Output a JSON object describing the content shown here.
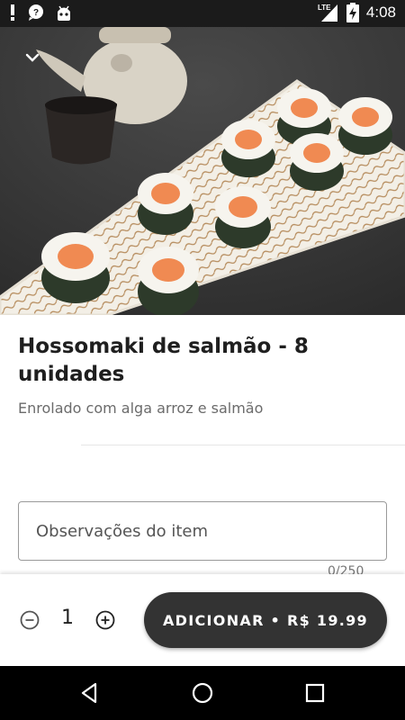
{
  "status_bar": {
    "time": "4:08",
    "network": "LTE",
    "icons": [
      "alert-icon",
      "chat-icon",
      "android-icon",
      "lte-signal-icon",
      "battery-charging-icon"
    ]
  },
  "hero": {
    "image": "sushi-photo",
    "collapse_icon": "chevron-down-icon"
  },
  "product": {
    "title": "Hossomaki de salmão - 8 unidades",
    "description": "Enrolado com alga arroz e salmão"
  },
  "notes": {
    "placeholder": "Observações do item",
    "value": "",
    "counter": "0/250"
  },
  "order": {
    "quantity": "1",
    "minus_icon": "minus-circle-icon",
    "plus_icon": "plus-circle-icon",
    "add_label": "ADICIONAR • R$ 19.99"
  },
  "nav": {
    "icons": [
      "back-icon",
      "home-icon",
      "recents-icon"
    ]
  },
  "colors": {
    "status_bar": "#1b1b1b",
    "button": "#333333",
    "nav_bar": "#000000"
  }
}
